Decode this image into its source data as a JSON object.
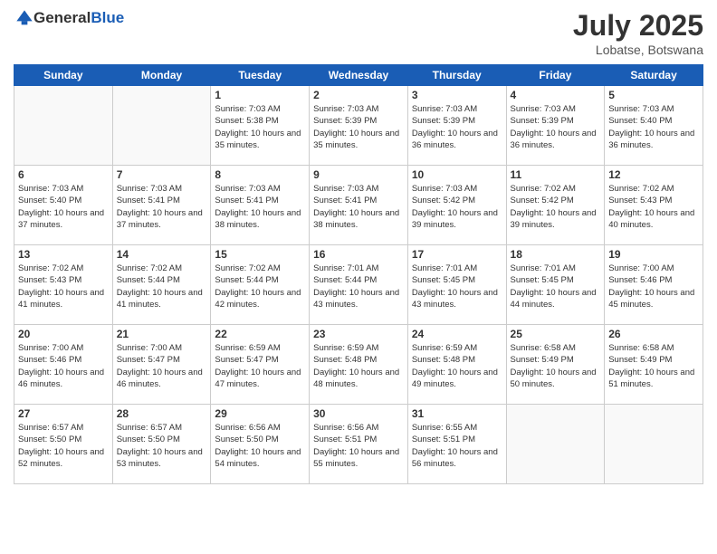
{
  "header": {
    "logo_general": "General",
    "logo_blue": "Blue",
    "title": "July 2025",
    "subtitle": "Lobatse, Botswana"
  },
  "days": [
    "Sunday",
    "Monday",
    "Tuesday",
    "Wednesday",
    "Thursday",
    "Friday",
    "Saturday"
  ],
  "weeks": [
    [
      {
        "day": "",
        "content": ""
      },
      {
        "day": "",
        "content": ""
      },
      {
        "day": "1",
        "content": "Sunrise: 7:03 AM\nSunset: 5:38 PM\nDaylight: 10 hours and 35 minutes."
      },
      {
        "day": "2",
        "content": "Sunrise: 7:03 AM\nSunset: 5:39 PM\nDaylight: 10 hours and 35 minutes."
      },
      {
        "day": "3",
        "content": "Sunrise: 7:03 AM\nSunset: 5:39 PM\nDaylight: 10 hours and 36 minutes."
      },
      {
        "day": "4",
        "content": "Sunrise: 7:03 AM\nSunset: 5:39 PM\nDaylight: 10 hours and 36 minutes."
      },
      {
        "day": "5",
        "content": "Sunrise: 7:03 AM\nSunset: 5:40 PM\nDaylight: 10 hours and 36 minutes."
      }
    ],
    [
      {
        "day": "6",
        "content": "Sunrise: 7:03 AM\nSunset: 5:40 PM\nDaylight: 10 hours and 37 minutes."
      },
      {
        "day": "7",
        "content": "Sunrise: 7:03 AM\nSunset: 5:41 PM\nDaylight: 10 hours and 37 minutes."
      },
      {
        "day": "8",
        "content": "Sunrise: 7:03 AM\nSunset: 5:41 PM\nDaylight: 10 hours and 38 minutes."
      },
      {
        "day": "9",
        "content": "Sunrise: 7:03 AM\nSunset: 5:41 PM\nDaylight: 10 hours and 38 minutes."
      },
      {
        "day": "10",
        "content": "Sunrise: 7:03 AM\nSunset: 5:42 PM\nDaylight: 10 hours and 39 minutes."
      },
      {
        "day": "11",
        "content": "Sunrise: 7:02 AM\nSunset: 5:42 PM\nDaylight: 10 hours and 39 minutes."
      },
      {
        "day": "12",
        "content": "Sunrise: 7:02 AM\nSunset: 5:43 PM\nDaylight: 10 hours and 40 minutes."
      }
    ],
    [
      {
        "day": "13",
        "content": "Sunrise: 7:02 AM\nSunset: 5:43 PM\nDaylight: 10 hours and 41 minutes."
      },
      {
        "day": "14",
        "content": "Sunrise: 7:02 AM\nSunset: 5:44 PM\nDaylight: 10 hours and 41 minutes."
      },
      {
        "day": "15",
        "content": "Sunrise: 7:02 AM\nSunset: 5:44 PM\nDaylight: 10 hours and 42 minutes."
      },
      {
        "day": "16",
        "content": "Sunrise: 7:01 AM\nSunset: 5:44 PM\nDaylight: 10 hours and 43 minutes."
      },
      {
        "day": "17",
        "content": "Sunrise: 7:01 AM\nSunset: 5:45 PM\nDaylight: 10 hours and 43 minutes."
      },
      {
        "day": "18",
        "content": "Sunrise: 7:01 AM\nSunset: 5:45 PM\nDaylight: 10 hours and 44 minutes."
      },
      {
        "day": "19",
        "content": "Sunrise: 7:00 AM\nSunset: 5:46 PM\nDaylight: 10 hours and 45 minutes."
      }
    ],
    [
      {
        "day": "20",
        "content": "Sunrise: 7:00 AM\nSunset: 5:46 PM\nDaylight: 10 hours and 46 minutes."
      },
      {
        "day": "21",
        "content": "Sunrise: 7:00 AM\nSunset: 5:47 PM\nDaylight: 10 hours and 46 minutes."
      },
      {
        "day": "22",
        "content": "Sunrise: 6:59 AM\nSunset: 5:47 PM\nDaylight: 10 hours and 47 minutes."
      },
      {
        "day": "23",
        "content": "Sunrise: 6:59 AM\nSunset: 5:48 PM\nDaylight: 10 hours and 48 minutes."
      },
      {
        "day": "24",
        "content": "Sunrise: 6:59 AM\nSunset: 5:48 PM\nDaylight: 10 hours and 49 minutes."
      },
      {
        "day": "25",
        "content": "Sunrise: 6:58 AM\nSunset: 5:49 PM\nDaylight: 10 hours and 50 minutes."
      },
      {
        "day": "26",
        "content": "Sunrise: 6:58 AM\nSunset: 5:49 PM\nDaylight: 10 hours and 51 minutes."
      }
    ],
    [
      {
        "day": "27",
        "content": "Sunrise: 6:57 AM\nSunset: 5:50 PM\nDaylight: 10 hours and 52 minutes."
      },
      {
        "day": "28",
        "content": "Sunrise: 6:57 AM\nSunset: 5:50 PM\nDaylight: 10 hours and 53 minutes."
      },
      {
        "day": "29",
        "content": "Sunrise: 6:56 AM\nSunset: 5:50 PM\nDaylight: 10 hours and 54 minutes."
      },
      {
        "day": "30",
        "content": "Sunrise: 6:56 AM\nSunset: 5:51 PM\nDaylight: 10 hours and 55 minutes."
      },
      {
        "day": "31",
        "content": "Sunrise: 6:55 AM\nSunset: 5:51 PM\nDaylight: 10 hours and 56 minutes."
      },
      {
        "day": "",
        "content": ""
      },
      {
        "day": "",
        "content": ""
      }
    ]
  ]
}
